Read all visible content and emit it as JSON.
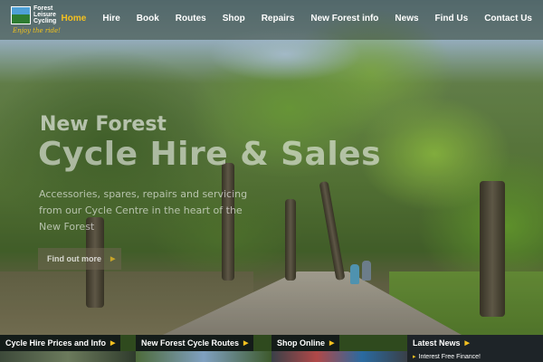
{
  "brand": {
    "line1": "Forest",
    "line2": "Leisure",
    "line3": "Cycling",
    "tagline": "Enjoy the ride!"
  },
  "nav": {
    "items": [
      {
        "label": "Home",
        "active": true
      },
      {
        "label": "Hire",
        "active": false
      },
      {
        "label": "Book",
        "active": false
      },
      {
        "label": "Routes",
        "active": false
      },
      {
        "label": "Shop",
        "active": false
      },
      {
        "label": "Repairs",
        "active": false
      },
      {
        "label": "New Forest info",
        "active": false
      },
      {
        "label": "News",
        "active": false
      },
      {
        "label": "Find Us",
        "active": false
      },
      {
        "label": "Contact Us",
        "active": false
      }
    ]
  },
  "hero": {
    "title_line1": "New Forest",
    "title_line2": "Cycle Hire & Sales",
    "subtitle": "Accessories, spares, repairs and servicing from our Cycle Centre in the heart of the New Forest",
    "cta_label": "Find out more",
    "cta_icon": "play-triangle-icon"
  },
  "panels": [
    {
      "label": "Cycle Hire Prices and Info",
      "icon": "play-triangle-icon"
    },
    {
      "label": "New Forest Cycle Routes",
      "icon": "play-triangle-icon"
    },
    {
      "label": "Shop Online",
      "icon": "play-triangle-icon"
    },
    {
      "label": "Latest News",
      "icon": "play-triangle-icon",
      "first_item": "Interest Free Finance!"
    }
  ],
  "colors": {
    "accent": "#f4c020",
    "nav_text": "#ffffff",
    "panel_bg": "#1e2428"
  }
}
